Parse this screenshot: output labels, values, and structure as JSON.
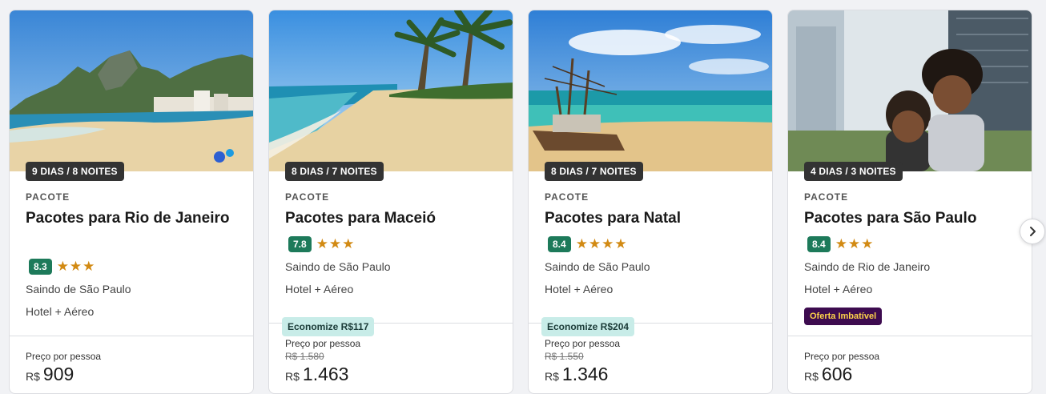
{
  "cards": [
    {
      "duration": "9 DIAS / 8 NOITES",
      "kind": "PACOTE",
      "title": "Pacotes para Rio de Janeiro",
      "score": "8.3",
      "stars": 3,
      "origin": "Saindo de São Paulo",
      "includes": "Hotel + Aéreo",
      "price_label": "Preço por pessoa",
      "currency": "R$",
      "price": "909"
    },
    {
      "duration": "8 DIAS / 7 NOITES",
      "kind": "PACOTE",
      "title": "Pacotes para Maceió",
      "score": "7.8",
      "stars": 3,
      "origin": "Saindo de São Paulo",
      "includes": "Hotel + Aéreo",
      "savings": "Economize R$117",
      "price_label": "Preço por pessoa",
      "old_price": "R$ 1.580",
      "currency": "R$",
      "price": "1.463"
    },
    {
      "duration": "8 DIAS / 7 NOITES",
      "kind": "PACOTE",
      "title": "Pacotes para Natal",
      "score": "8.4",
      "stars": 4,
      "origin": "Saindo de São Paulo",
      "includes": "Hotel + Aéreo",
      "savings": "Economize R$204",
      "price_label": "Preço por pessoa",
      "old_price": "R$ 1.550",
      "currency": "R$",
      "price": "1.346"
    },
    {
      "duration": "4 DIAS / 3 NOITES",
      "kind": "PACOTE",
      "title": "Pacotes para São Paulo",
      "score": "8.4",
      "stars": 3,
      "origin": "Saindo de Rio de Janeiro",
      "includes": "Hotel + Aéreo",
      "badge": "Oferta Imbatível",
      "price_label": "Preço por pessoa",
      "currency": "R$",
      "price": "606"
    }
  ],
  "stars_glyphs": {
    "three": "★★★",
    "four": "★★★★"
  },
  "carousel": {
    "next_icon": "chevron-right-icon"
  },
  "colors": {
    "score_bg": "#1d7a5a",
    "star": "#d28a13",
    "savings_bg": "#c8ece8",
    "offer_bg": "#3d0b4f",
    "offer_text": "#ffd54a"
  }
}
